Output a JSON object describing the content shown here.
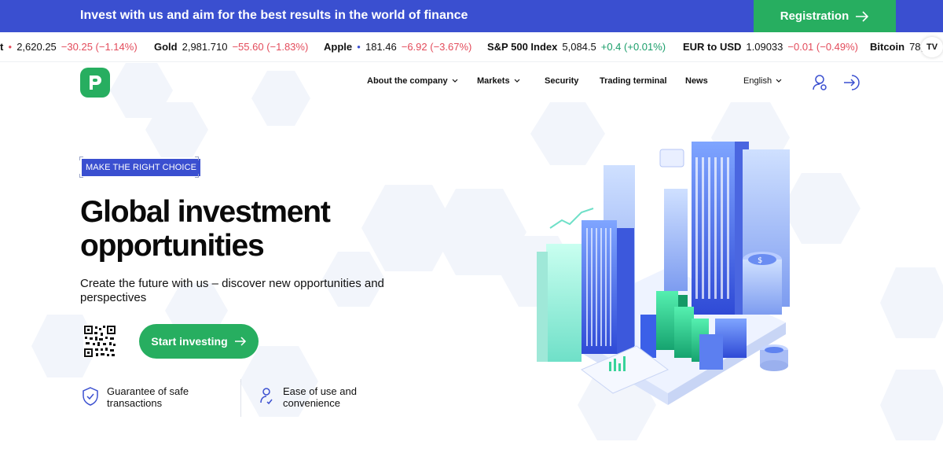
{
  "banner": {
    "text": "Invest with us and aim for the best results in the world of finance",
    "registration_label": "Registration"
  },
  "ticker": [
    {
      "name": "t",
      "price": "2,620.25",
      "change": "−30.25 (−1.14%)",
      "dir": "dn"
    },
    {
      "name": "Gold",
      "price": "2,981.710",
      "change": "−55.60 (−1.83%)",
      "dir": "dn"
    },
    {
      "name": "Apple",
      "price": "181.46",
      "change": "−6.92 (−3.67%)",
      "dir": "dn"
    },
    {
      "name": "S&P 500 Index",
      "price": "5,084.5",
      "change": "+0.4 (+0.01%)",
      "dir": "up"
    },
    {
      "name": "EUR to USD",
      "price": "1.09033",
      "change": "−0.01 (−0.49%)",
      "dir": "dn"
    },
    {
      "name": "Bitcoin",
      "price": "78,",
      "change": "",
      "dir": "up"
    }
  ],
  "tradingview_logo": "TV",
  "nav": {
    "about": "About the company",
    "markets": "Markets",
    "security": "Security",
    "terminal": "Trading terminal",
    "news": "News",
    "language": "English"
  },
  "hero": {
    "tag": "MAKE THE RIGHT CHOICE",
    "headline_line1": "Global investment",
    "headline_line2": "opportunities",
    "subtitle": "Create the future with us – discover new opportunities and perspectives",
    "start_label": "Start investing"
  },
  "features": [
    {
      "text": "Guarantee of safe transactions"
    },
    {
      "text": "Ease of use and convenience"
    }
  ],
  "colors": {
    "brand_blue": "#3a4fd0",
    "brand_green": "#27ae60",
    "up": "#1a9e6a",
    "down": "#e34b5b"
  }
}
